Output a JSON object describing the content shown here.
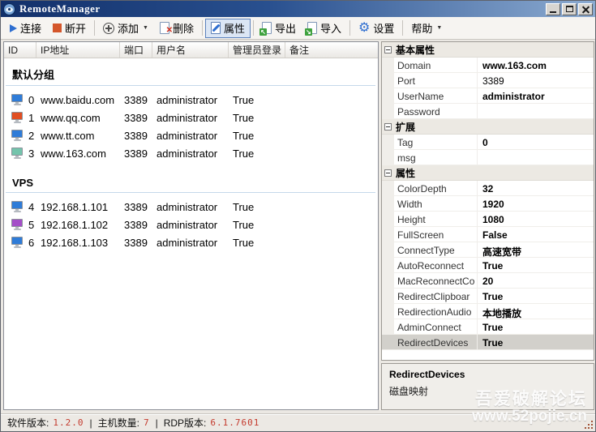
{
  "window": {
    "title": "RemoteManager"
  },
  "toolbar": {
    "buttons": [
      {
        "id": "connect",
        "label": "连接",
        "icon": "play-icon"
      },
      {
        "id": "disconnect",
        "label": "断开",
        "icon": "stop-icon"
      },
      {
        "id": "add",
        "label": "添加",
        "icon": "add-circle-icon",
        "dropdown": true,
        "separator_before": true
      },
      {
        "id": "delete",
        "label": "删除",
        "icon": "delete-icon"
      },
      {
        "id": "properties",
        "label": "属性",
        "icon": "properties-icon",
        "active": true,
        "separator_before": true
      },
      {
        "id": "export",
        "label": "导出",
        "icon": "export-icon",
        "separator_before": true
      },
      {
        "id": "import",
        "label": "导入",
        "icon": "import-icon"
      },
      {
        "id": "settings",
        "label": "设置",
        "icon": "gear-icon",
        "separator_before": true
      },
      {
        "id": "help",
        "label": "帮助",
        "dropdown": true,
        "separator_before": true
      }
    ]
  },
  "host_list": {
    "columns": [
      "ID",
      "IP地址",
      "端口",
      "用户名",
      "管理员登录",
      "备注"
    ],
    "groups": [
      {
        "name": "默认分组",
        "rows": [
          {
            "id": "0",
            "ip": "www.baidu.com",
            "port": "3389",
            "user": "administrator",
            "admin": "True",
            "note": "",
            "icon_color": "#2f7cd8"
          },
          {
            "id": "1",
            "ip": "www.qq.com",
            "port": "3389",
            "user": "administrator",
            "admin": "True",
            "note": "",
            "icon_color": "#e14e22"
          },
          {
            "id": "2",
            "ip": "www.tt.com",
            "port": "3389",
            "user": "administrator",
            "admin": "True",
            "note": "",
            "icon_color": "#2f7cd8"
          },
          {
            "id": "3",
            "ip": "www.163.com",
            "port": "3389",
            "user": "administrator",
            "admin": "True",
            "note": "",
            "icon_color": "#74c4ac"
          }
        ]
      },
      {
        "name": "VPS",
        "rows": [
          {
            "id": "4",
            "ip": "192.168.1.101",
            "port": "3389",
            "user": "administrator",
            "admin": "True",
            "note": "",
            "icon_color": "#2f7cd8"
          },
          {
            "id": "5",
            "ip": "192.168.1.102",
            "port": "3389",
            "user": "administrator",
            "admin": "True",
            "note": "",
            "icon_color": "#a44fc8"
          },
          {
            "id": "6",
            "ip": "192.168.1.103",
            "port": "3389",
            "user": "administrator",
            "admin": "True",
            "note": "",
            "icon_color": "#2f7cd8"
          }
        ]
      }
    ]
  },
  "property_grid": {
    "sections": [
      {
        "title": "基本属性",
        "rows": [
          {
            "label": "Domain",
            "value": "www.163.com",
            "bold": true
          },
          {
            "label": "Port",
            "value": "3389",
            "bold": false
          },
          {
            "label": "UserName",
            "value": "administrator",
            "bold": true
          },
          {
            "label": "Password",
            "value": "",
            "bold": false
          }
        ]
      },
      {
        "title": "扩展",
        "rows": [
          {
            "label": "Tag",
            "value": "0",
            "bold": true
          },
          {
            "label": "msg",
            "value": "",
            "bold": false
          }
        ]
      },
      {
        "title": "属性",
        "rows": [
          {
            "label": "ColorDepth",
            "value": "32",
            "bold": true
          },
          {
            "label": "Width",
            "value": "1920",
            "bold": true
          },
          {
            "label": "Height",
            "value": "1080",
            "bold": true
          },
          {
            "label": "FullScreen",
            "value": "False",
            "bold": true
          },
          {
            "label": "ConnectType",
            "value": "高速宽带",
            "bold": true
          },
          {
            "label": "AutoReconnect",
            "value": "True",
            "bold": true
          },
          {
            "label": "MacReconnectCo",
            "value": "20",
            "bold": true
          },
          {
            "label": "RedirectClipboar",
            "value": "True",
            "bold": true
          },
          {
            "label": "RedirectionAudio",
            "value": "本地播放",
            "bold": true
          },
          {
            "label": "AdminConnect",
            "value": "True",
            "bold": true
          },
          {
            "label": "RedirectDevices",
            "value": "True",
            "bold": true,
            "selected": true
          }
        ]
      }
    ],
    "description": {
      "title": "RedirectDevices",
      "text": "磁盘映射"
    }
  },
  "watermark": {
    "line1": "吾爱破解论坛",
    "line2": "www.52pojie.cn"
  },
  "status_bar": {
    "separator": "|",
    "items": [
      {
        "label": "软件版本:",
        "value": "1.2.0"
      },
      {
        "label": "主机数量:",
        "value": "7"
      },
      {
        "label": "RDP版本:",
        "value": "6.1.7601"
      }
    ]
  }
}
